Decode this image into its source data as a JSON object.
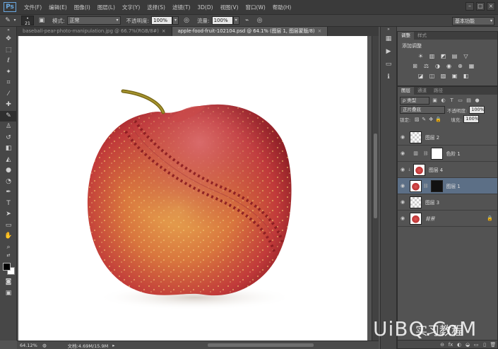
{
  "app": {
    "logo": "Ps"
  },
  "menu": [
    "文件(F)",
    "编辑(E)",
    "图像(I)",
    "图层(L)",
    "文字(Y)",
    "选择(S)",
    "滤镜(T)",
    "3D(D)",
    "视图(V)",
    "窗口(W)",
    "帮助(H)"
  ],
  "window_controls": {
    "minimize": "–",
    "maximize": "□",
    "close": "×"
  },
  "options": {
    "brush_size": "21",
    "mode_label": "模式:",
    "mode_value": "正常",
    "opacity_label": "不透明度:",
    "opacity_value": "100%",
    "flow_label": "流量:",
    "flow_value": "100%",
    "workspace": "基本功能"
  },
  "tabs": [
    {
      "label": "baseball-pear-photo-manipulation.jpg @ 66.7%(RGB/8#)",
      "close": "×"
    },
    {
      "label": "apple-food-fruit-102104.psd @ 64.1% (图层 1, 图层蒙版/8)",
      "close": "×"
    }
  ],
  "status": {
    "zoom": "64.12%",
    "doc": "文档:4.69M/15.9M"
  },
  "adjustments": {
    "tabs": [
      "调整",
      "样式"
    ],
    "title": "添加调整",
    "row1": [
      "☀",
      "▥",
      "◩",
      "▤",
      "▽"
    ],
    "row2": [
      "⊞",
      "⚖",
      "◑",
      "◉",
      "⊕",
      "▦"
    ],
    "row3": [
      "◪",
      "◫",
      "▨",
      "▣",
      "◧"
    ]
  },
  "layers_panel": {
    "tabs": [
      "图层",
      "通道",
      "路径"
    ],
    "filter_label": "ρ 类型",
    "blend_mode": "正片叠底",
    "opacity_label": "不透明度:",
    "opacity_value": "100%",
    "lock_label": "锁定:",
    "fill_label": "填充:",
    "fill_value": "100%",
    "layers": [
      {
        "name": "图层 2"
      },
      {
        "name": "色阶 1"
      },
      {
        "name": "图层 4"
      },
      {
        "name": "图层 1"
      },
      {
        "name": "图层 3"
      },
      {
        "name": "背景"
      }
    ],
    "footer_icons": [
      "⊖",
      "fx",
      "◐",
      "◒",
      "▭",
      "▯",
      "🗑"
    ]
  },
  "watermark": {
    "main": "UiBQ.CoM",
    "sub": "实习教程"
  },
  "colors": {
    "accent": "#5c6f86",
    "background": "#535353"
  }
}
